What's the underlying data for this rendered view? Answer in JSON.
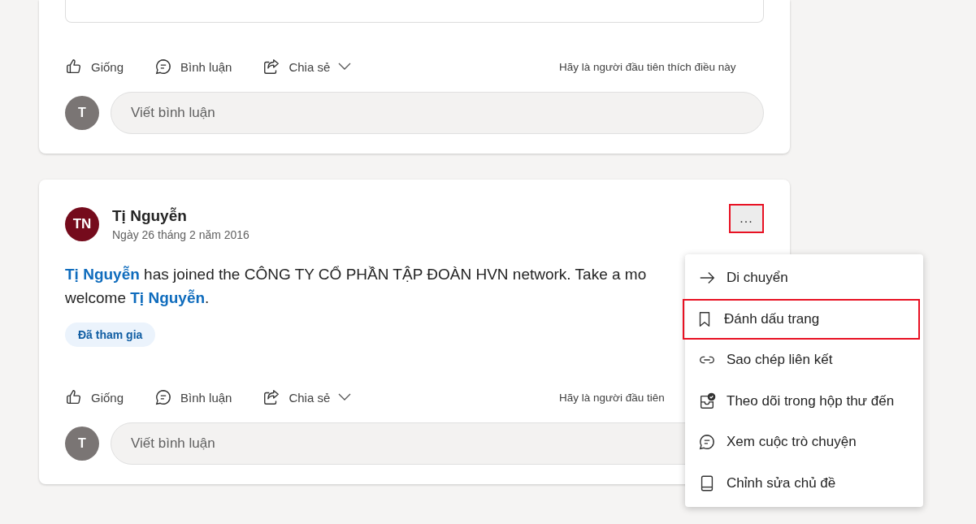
{
  "posts": [
    {
      "actions": [
        {
          "kind": "like",
          "label": "Giống"
        },
        {
          "kind": "comment",
          "label": "Bình luận"
        },
        {
          "kind": "share",
          "label": "Chia sẻ"
        }
      ],
      "like_hint": "Hãy là người đầu tiên thích điều này",
      "comment": {
        "avatar": "T",
        "placeholder": "Viết bình luận"
      }
    },
    {
      "header": {
        "avatar": "TN",
        "author": "Tị Nguyễn",
        "date": "Ngày 26 tháng 2 năm 2016",
        "more": "...",
        "more_highlighted": true
      },
      "body": [
        [
          {
            "kind": "link",
            "text": "Tị Nguyễn"
          },
          {
            "kind": "text",
            "text": " has joined the CÔNG TY CỔ PHẦN TẬP ĐOÀN HVN network. Take a mo"
          }
        ],
        [
          {
            "kind": "text",
            "text": "welcome "
          },
          {
            "kind": "link",
            "text": "Tị Nguyễn"
          },
          {
            "kind": "text",
            "text": "."
          }
        ]
      ],
      "badge": "Đã tham gia",
      "actions": [
        {
          "kind": "like",
          "label": "Giống"
        },
        {
          "kind": "comment",
          "label": "Bình luận"
        },
        {
          "kind": "share",
          "label": "Chia sẻ"
        }
      ],
      "like_hint": "Hãy là người đầu tiên",
      "comment": {
        "avatar": "T",
        "placeholder": "Viết bình luận"
      }
    }
  ],
  "menu": [
    {
      "kind": "move",
      "label": "Di chuyển",
      "highlighted": false
    },
    {
      "kind": "bookmark",
      "label": "Đánh dấu trang",
      "highlighted": true
    },
    {
      "kind": "link",
      "label": "Sao chép liên kết",
      "highlighted": false
    },
    {
      "kind": "inbox",
      "label": "Theo dõi trong hộp thư đến",
      "highlighted": false
    },
    {
      "kind": "chat",
      "label": "Xem cuộc trò chuyện",
      "highlighted": false
    },
    {
      "kind": "book",
      "label": "Chỉnh sửa chủ đề",
      "highlighted": false
    }
  ]
}
